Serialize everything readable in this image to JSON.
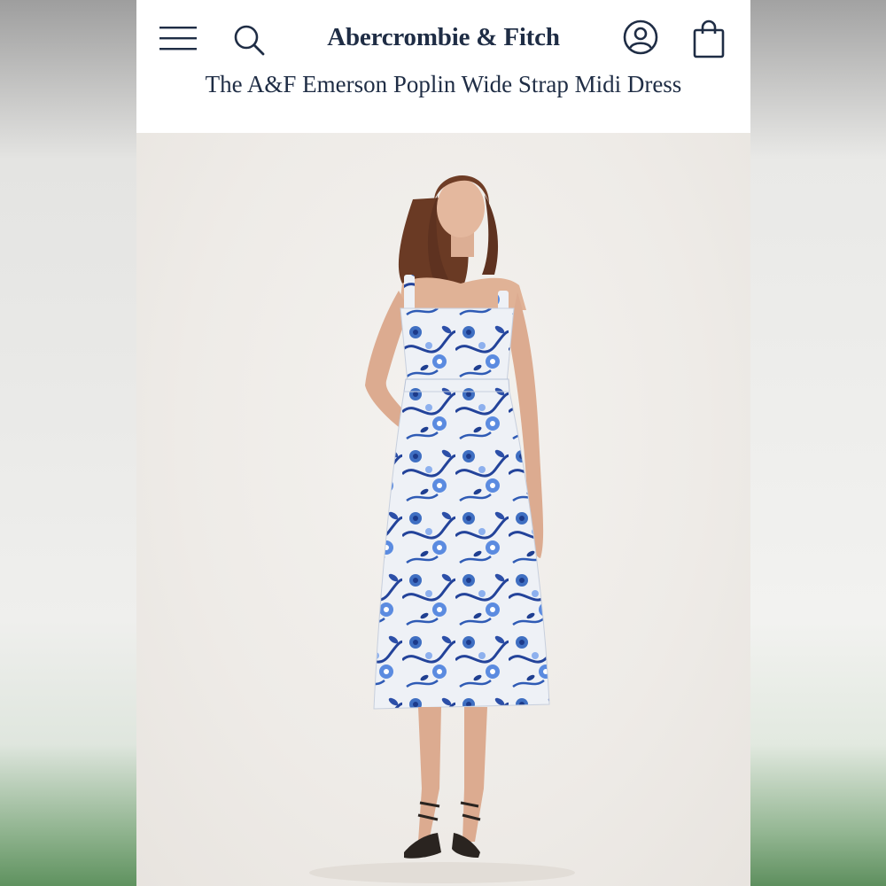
{
  "brand": {
    "name": "Abercrombie & Fitch"
  },
  "product": {
    "title": "The A&F Emerson Poplin Wide Strap Midi Dress"
  },
  "header": {
    "icons": [
      "menu-icon",
      "search-icon",
      "account-icon",
      "shopping-bag-icon"
    ]
  },
  "colors": {
    "brand_text": "#1f2d45",
    "header_bg": "#ffffff",
    "photo_bg": "#efedea",
    "dress_print_blue": "#3f6fc2",
    "dress_base": "#eef1f6"
  }
}
